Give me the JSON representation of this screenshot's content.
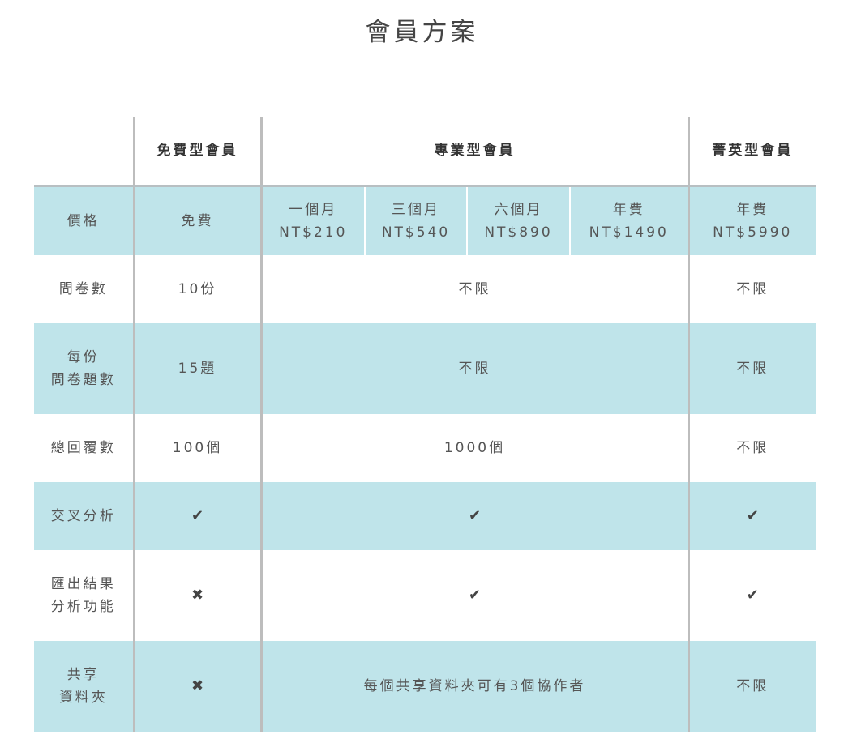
{
  "page_title": "會員方案",
  "columns": {
    "free": "免費型會員",
    "pro": "專業型會員",
    "elite": "菁英型會員"
  },
  "price": {
    "label": "價格",
    "free": "免費",
    "pro_monthly": {
      "line1": "一個月",
      "line2": "NT$210"
    },
    "pro_quarter": {
      "line1": "三個月",
      "line2": "NT$540"
    },
    "pro_half": {
      "line1": "六個月",
      "line2": "NT$890"
    },
    "pro_year": {
      "line1": "年費",
      "line2": "NT$1490"
    },
    "elite_year": {
      "line1": "年費",
      "line2": "NT$5990"
    }
  },
  "rows": {
    "surveys": {
      "label": "問卷數",
      "free": "10份",
      "pro": "不限",
      "elite": "不限"
    },
    "questions": {
      "label_line1": "每份",
      "label_line2": "問卷題數",
      "free": "15題",
      "pro": "不限",
      "elite": "不限"
    },
    "responses": {
      "label": "總回覆數",
      "free": "100個",
      "pro": "1000個",
      "elite": "不限"
    },
    "cross": {
      "label": "交叉分析",
      "free": "✔",
      "pro": "✔",
      "elite": "✔"
    },
    "export": {
      "label_line1": "匯出結果",
      "label_line2": "分析功能",
      "free": "✖",
      "pro": "✔",
      "elite": "✔"
    },
    "shared": {
      "label_line1": "共享",
      "label_line2": "資料夾",
      "free": "✖",
      "pro": "每個共享資料夾可有3個協作者",
      "elite": "不限"
    }
  }
}
